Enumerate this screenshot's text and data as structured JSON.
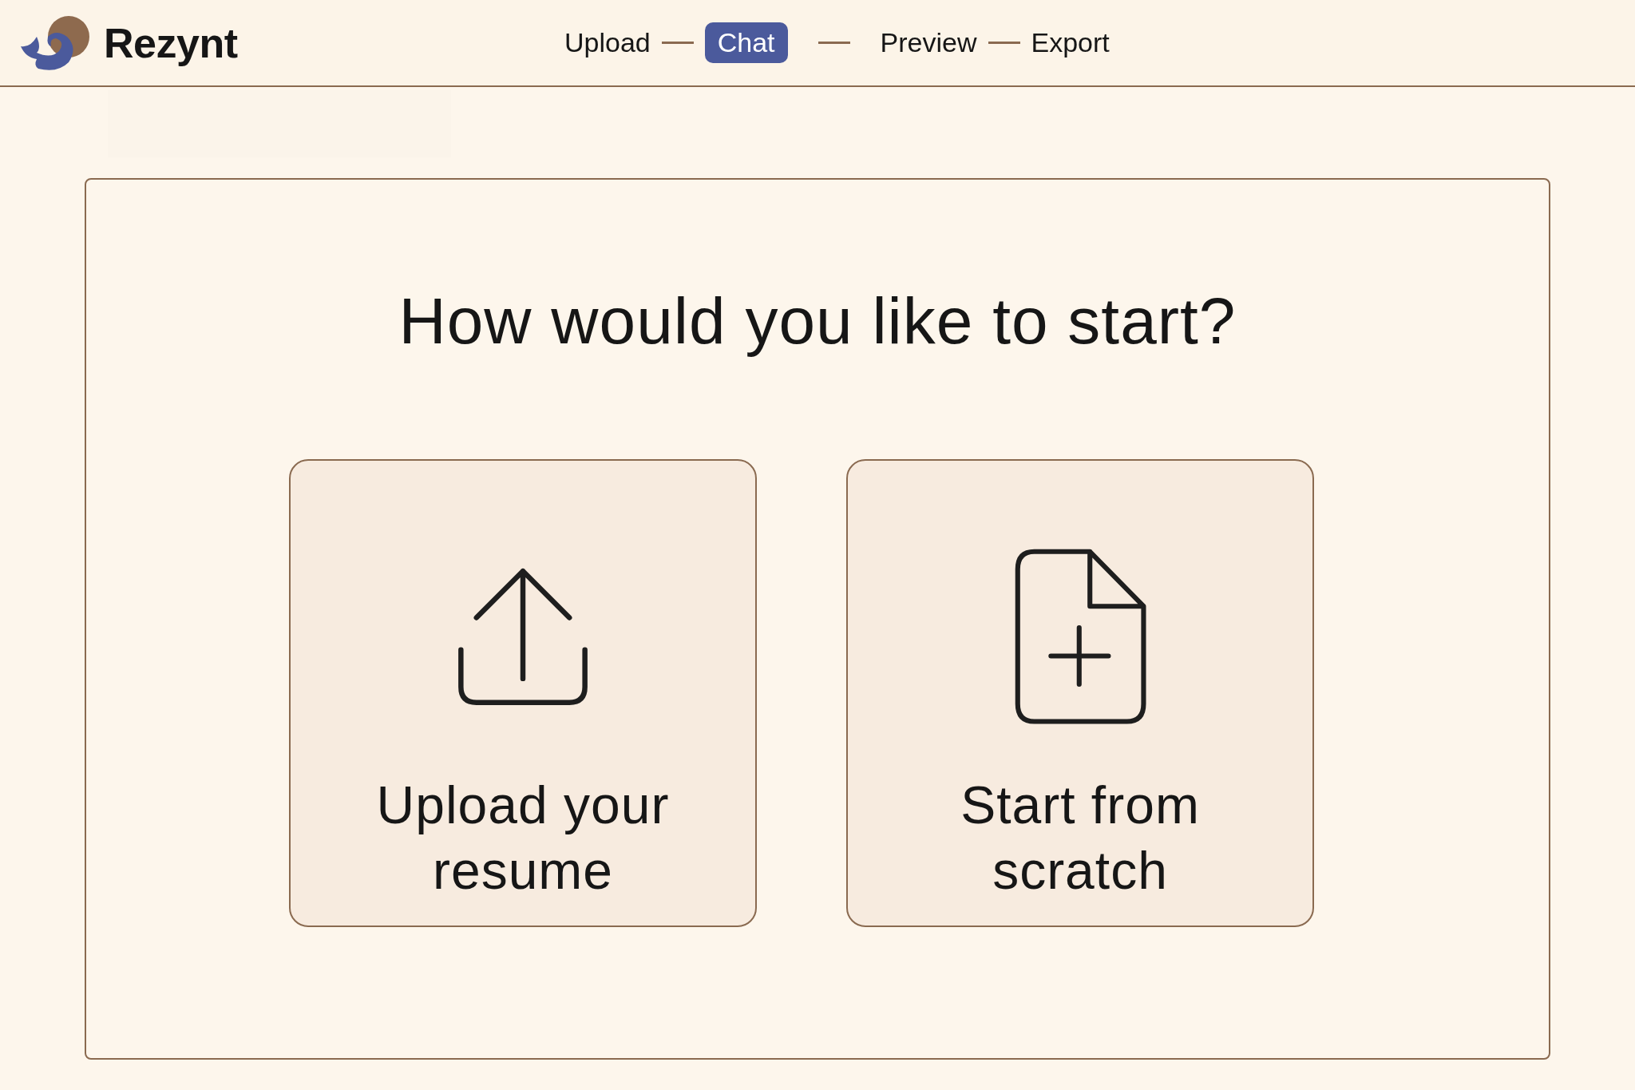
{
  "brand": {
    "name": "Rezynt"
  },
  "steps": [
    {
      "label": "Upload",
      "selected": false
    },
    {
      "label": "Chat",
      "selected": true
    },
    {
      "label": "Preview",
      "selected": false
    },
    {
      "label": "Export",
      "selected": false
    }
  ],
  "prompt": {
    "title": "How would you like to start?"
  },
  "options": [
    {
      "kind": "upload",
      "label": "Upload your resume"
    },
    {
      "kind": "new-file",
      "label": "Start from scratch"
    }
  ]
}
